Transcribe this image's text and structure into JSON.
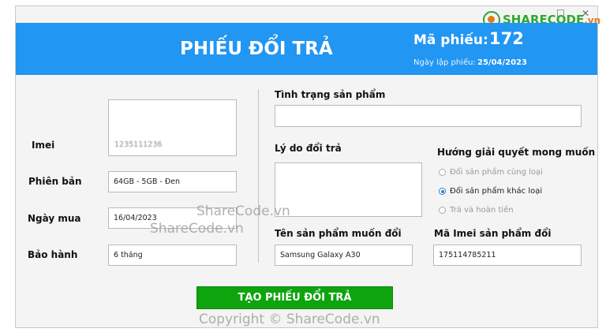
{
  "header": {
    "title": "PHIẾU ĐỔI TRẢ",
    "ma_phieu_label": "Mã phiếu:",
    "ma_phieu_value": "172",
    "ngay_lap_label": "Ngày lập phiếu:",
    "ngay_lap_value": "25/04/2023"
  },
  "left": {
    "imei_label": "Imei",
    "imei_value": "1235111236",
    "phien_ban_label": "Phiên bản",
    "phien_ban_value": "64GB - 5GB - Đen",
    "ngay_mua_label": "Ngày mua",
    "ngay_mua_value": "16/04/2023",
    "bao_hanh_label": "Bảo hành",
    "bao_hanh_value": "6 tháng"
  },
  "right": {
    "tinh_trang_label": "Tình trạng sản phẩm",
    "ly_do_label": "Lý do đổi trả",
    "huong_giai_quyet_label": "Hướng giải quyết mong muốn",
    "options": [
      "Đổi sản phẩm cùng loại",
      "Đổi sản phẩm khác loại",
      "Trả và hoàn tiền"
    ],
    "selected_option": "Đổi sản phẩm khác loại",
    "ten_sp_label": "Tên sản phẩm muốn đổi",
    "ten_sp_value": "Samsung Galaxy A30",
    "ma_imei_label": "Mã Imei sản phẩm đổi",
    "ma_imei_value": "175114785211"
  },
  "submit_label": "TẠO PHIẾU ĐỔI TRẢ",
  "watermark": {
    "logo_text": "SHARECODE",
    "logo_domain": ".vn",
    "mid1": "ShareCode.vn",
    "mid2": "ShareCode.vn",
    "copyright": "Copyright © ShareCode.vn"
  },
  "colors": {
    "header": "#2196f3",
    "button": "#0ea40e",
    "radio_accent": "#2d7fd8"
  }
}
